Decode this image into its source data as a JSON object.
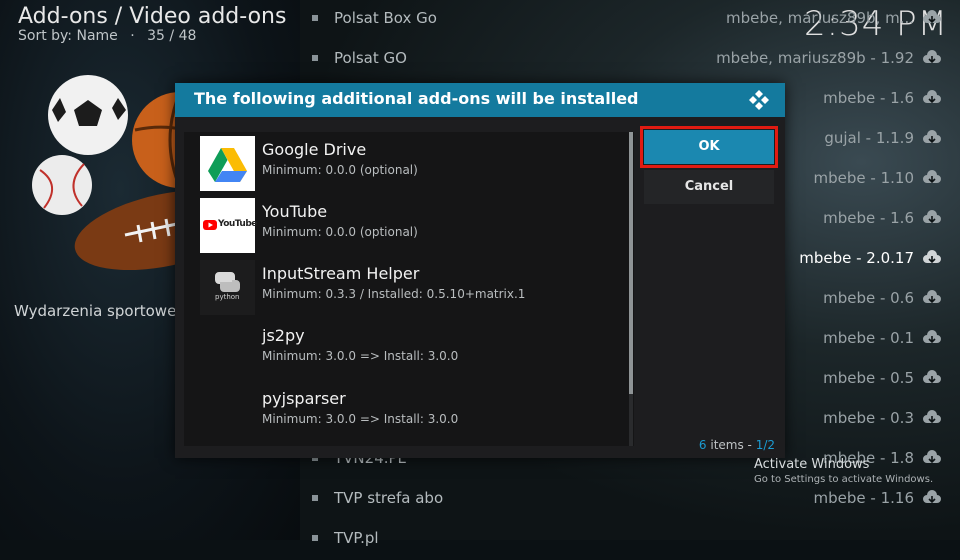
{
  "header": {
    "title": "Add-ons / Video add-ons",
    "sort": "Sort by: Name",
    "separator": "·",
    "position": "35 / 48"
  },
  "clock": "2:34 PM",
  "category": "Wydarzenia sportowe",
  "background_list": [
    {
      "name": "Polsat Box Go",
      "version": "mbebe, mariusz89b, m..."
    },
    {
      "name": "Polsat GO",
      "version": "mbebe, mariusz89b - 1.92"
    },
    {
      "name": "",
      "version": "mbebe - 1.6"
    },
    {
      "name": "",
      "version": "gujal - 1.1.9"
    },
    {
      "name": "",
      "version": "mbebe - 1.10"
    },
    {
      "name": "",
      "version": "mbebe - 1.6"
    },
    {
      "name": "",
      "version": "mbebe - 2.0.17"
    },
    {
      "name": "",
      "version": "mbebe - 0.6"
    },
    {
      "name": "",
      "version": "mbebe - 0.1"
    },
    {
      "name": "",
      "version": "mbebe - 0.5"
    },
    {
      "name": "",
      "version": "mbebe - 0.3"
    },
    {
      "name": "TVN24.PL",
      "version": "mbebe - 1.8"
    },
    {
      "name": "TVP strefa abo",
      "version": "mbebe - 1.16"
    },
    {
      "name": "TVP.pl",
      "version": ""
    }
  ],
  "dialog": {
    "title": "The following additional add-ons will be installed",
    "items": [
      {
        "name": "Google Drive",
        "detail": "Minimum: 0.0.0 (optional)",
        "icon": "google-drive-icon"
      },
      {
        "name": "YouTube",
        "detail": "Minimum: 0.0.0 (optional)",
        "icon": "youtube-icon",
        "logo_text": "YouTube"
      },
      {
        "name": "InputStream Helper",
        "detail": "Minimum: 0.3.3 / Installed: 0.5.10+matrix.1",
        "icon": "python-icon",
        "logo_text": "python"
      },
      {
        "name": "js2py",
        "detail": "Minimum: 3.0.0 => Install: 3.0.0",
        "icon": ""
      },
      {
        "name": "pyjsparser",
        "detail": "Minimum: 3.0.0 => Install: 3.0.0",
        "icon": ""
      }
    ],
    "ok_label": "OK",
    "cancel_label": "Cancel",
    "count_text": "6",
    "count_suffix": " items - ",
    "page_text": "1/2"
  },
  "watermark": {
    "title": "Activate Windows",
    "subtitle": "Go to Settings to activate Windows."
  },
  "colors": {
    "dialog_header": "#147a9e",
    "ok_button": "#1b88b0",
    "highlight_border": "#e11b12",
    "accent_text": "#1b9bd1"
  }
}
